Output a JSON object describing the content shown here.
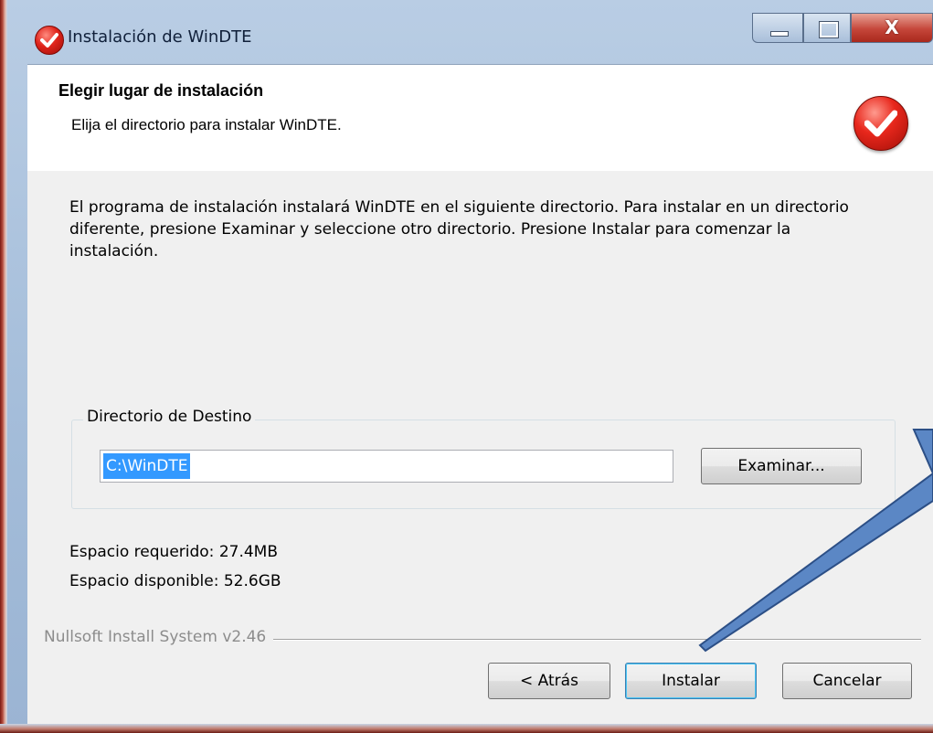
{
  "window": {
    "title": "Instalación de WinDTE",
    "controls": {
      "minimize_icon": "minimize-icon",
      "maximize_icon": "maximize-icon",
      "close_label": "X"
    }
  },
  "header": {
    "title": "Elegir lugar de instalación",
    "subtitle": "Elija el directorio para instalar WinDTE.",
    "logo_icon": "windte-check-logo"
  },
  "body": {
    "description": "El programa de instalación instalará WinDTE en el siguiente directorio. Para instalar en un directorio diferente, presione Examinar y seleccione otro directorio. Presione Instalar para comenzar la instalación.",
    "destination_group_label": "Directorio de Destino",
    "destination_path": "C:\\WinDTE",
    "browse_button": "Examinar...",
    "space_required": "Espacio requerido: 27.4MB",
    "space_available": "Espacio disponible: 52.6GB"
  },
  "footer": {
    "branding": "Nullsoft Install System v2.46",
    "back_button": "< Atrás",
    "install_button": "Instalar",
    "cancel_button": "Cancelar"
  },
  "colors": {
    "frame": "#a3bcd9",
    "accent_red": "#e0241b",
    "selection": "#3399ff",
    "annotation_arrow": "#5b87c5"
  }
}
